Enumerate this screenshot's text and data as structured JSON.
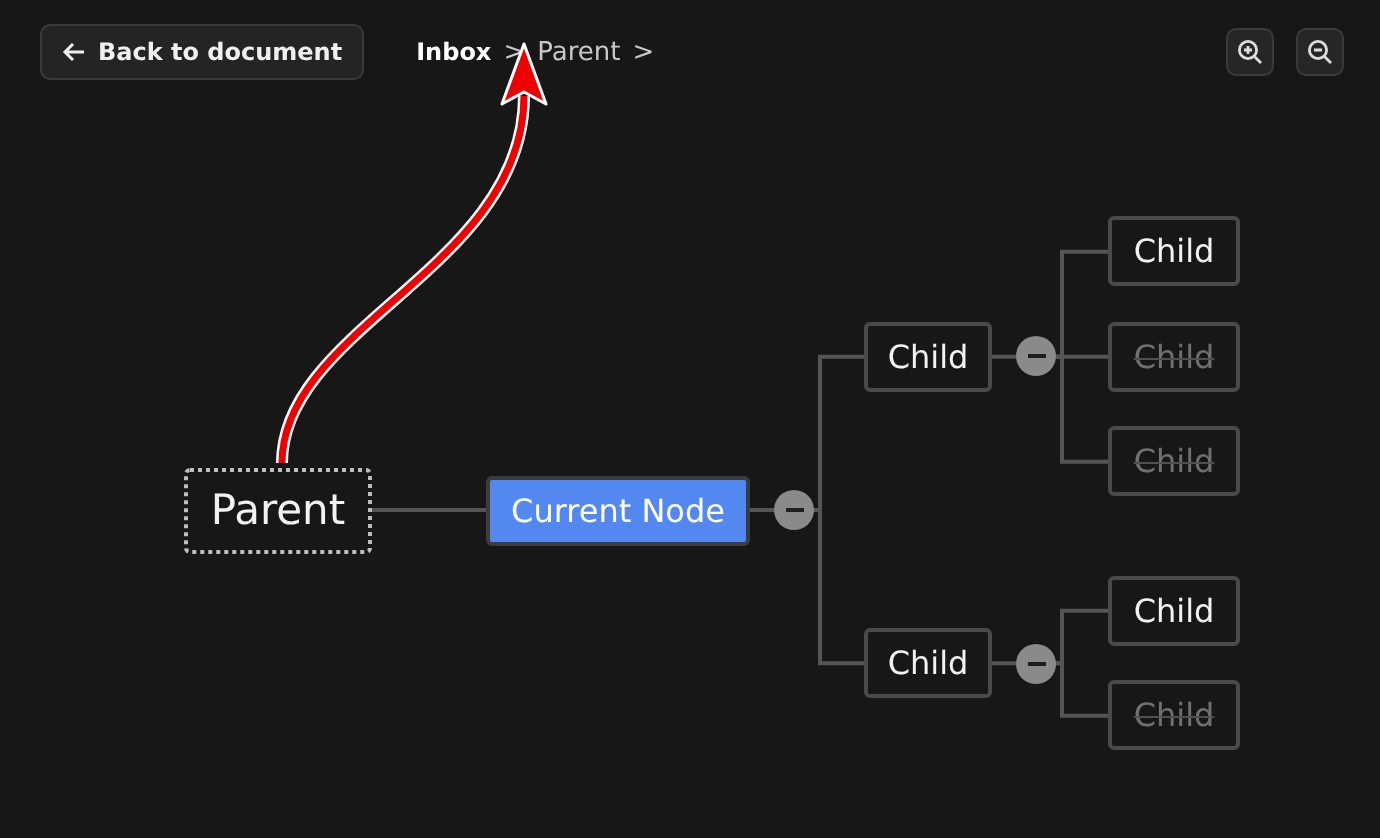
{
  "back_button": {
    "label": "Back to document"
  },
  "breadcrumb": [
    {
      "label": "Inbox",
      "kind": "root"
    },
    {
      "label": ">",
      "kind": "separator"
    },
    {
      "label": "Parent",
      "kind": "crumb"
    },
    {
      "label": ">",
      "kind": "separator"
    }
  ],
  "map": {
    "label": "Parent",
    "kind": "parent",
    "selected": false,
    "completed": false,
    "expanded": false,
    "children": [
      {
        "label": "Current Node",
        "kind": "node",
        "selected": true,
        "completed": false,
        "expanded": true,
        "children": [
          {
            "label": "Child",
            "kind": "node",
            "selected": false,
            "completed": false,
            "expanded": true,
            "children": [
              {
                "label": "Child",
                "kind": "node",
                "selected": false,
                "completed": false,
                "expanded": false
              },
              {
                "label": "Child",
                "kind": "node",
                "selected": false,
                "completed": true,
                "expanded": false
              },
              {
                "label": "Child",
                "kind": "node",
                "selected": false,
                "completed": true,
                "expanded": false
              }
            ]
          },
          {
            "label": "Child",
            "kind": "node",
            "selected": false,
            "completed": false,
            "expanded": true,
            "children": [
              {
                "label": "Child",
                "kind": "node",
                "selected": false,
                "completed": false,
                "expanded": false
              },
              {
                "label": "Child",
                "kind": "node",
                "selected": false,
                "completed": true,
                "expanded": false
              }
            ]
          }
        ]
      }
    ]
  }
}
